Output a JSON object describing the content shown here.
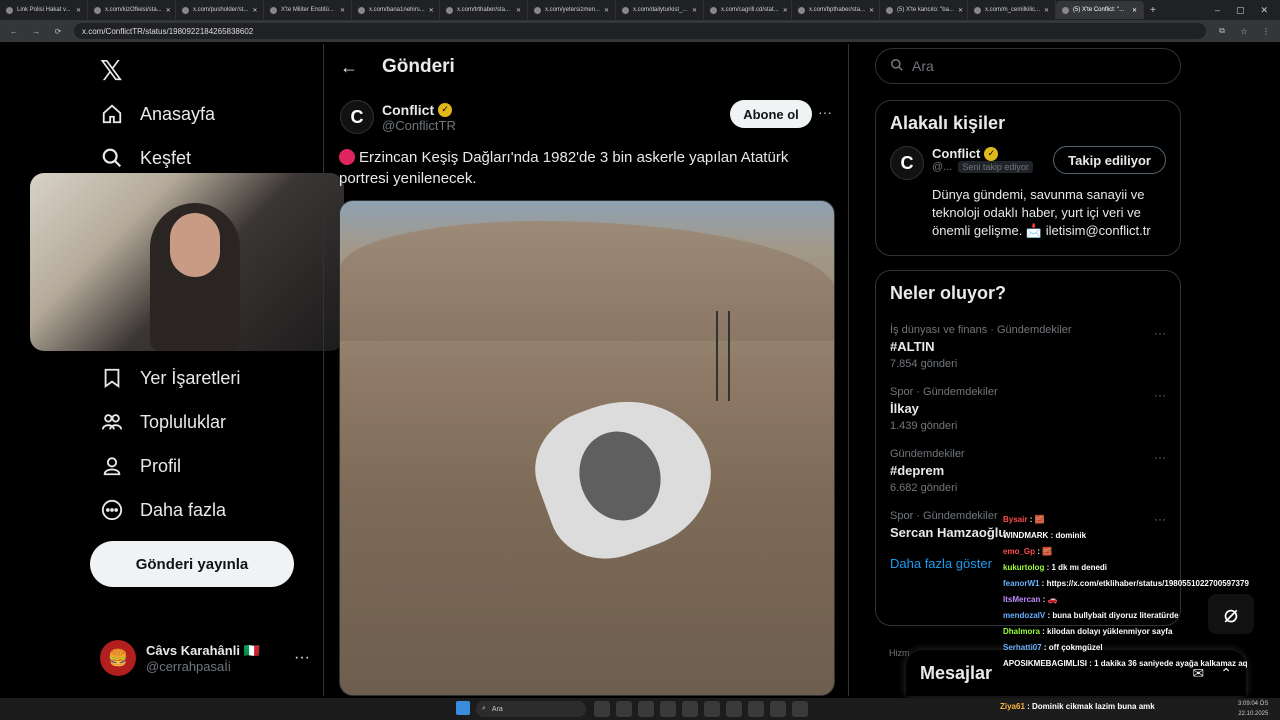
{
  "browser": {
    "tabs": [
      {
        "label": "Link Polisi Hakat v..."
      },
      {
        "label": "x.com/kizOfkesi/sta..."
      },
      {
        "label": "x.com/pusholder/st..."
      },
      {
        "label": "X'te Militer Enstitü..."
      },
      {
        "label": "x.com/bana1nehirs..."
      },
      {
        "label": "x.com/trthaber/sta..."
      },
      {
        "label": "x.com/yetersizmen..."
      },
      {
        "label": "x.com/dailyturkist_..."
      },
      {
        "label": "x.com/cagrill.cd/stat..."
      },
      {
        "label": "x.com/bpthaber/sta..."
      },
      {
        "label": "(5) X'te kancılo: \"ba..."
      },
      {
        "label": "x.com/m_cemilkilic..."
      },
      {
        "label": "(5) X'te Conflict: \"..."
      }
    ],
    "url": "x.com/ConflictTR/status/1980922184265838602"
  },
  "sidebar": {
    "items": [
      {
        "label": "Anasayfa"
      },
      {
        "label": "Keşfet"
      },
      {
        "label": "Yer İşaretleri"
      },
      {
        "label": "Topluluklar"
      },
      {
        "label": "Profil"
      },
      {
        "label": "Daha fazla"
      }
    ],
    "post_button": "Gönderi yayınla",
    "account": {
      "name": "Câvs Karahânli 🇮🇹",
      "handle": "@cerrahpasaİi"
    }
  },
  "main": {
    "title": "Gönderi",
    "post": {
      "author": "Conflict",
      "handle": "@ConflictTR",
      "subscribe_label": "Abone ol",
      "text": "Erzincan Keşiş Dağları'nda 1982'de 3 bin askerle yapılan Atatürk portresi yenilenecek."
    }
  },
  "right": {
    "search_placeholder": "Ara",
    "related": {
      "title": "Alakalı kişiler",
      "name": "Conflict",
      "handle": "@...",
      "badge": "Seni takip ediyor",
      "button": "Takip ediliyor",
      "bio": "Dünya gündemi, savunma sanayii ve teknoloji odaklı haber, yurt içi veri ve önemli gelişme. 📩 iletisim@conflict.tr"
    },
    "trends": {
      "title": "Neler oluyor?",
      "items": [
        {
          "context": "İş dünyası ve finans · Gündemdekiler",
          "name": "#ALTIN",
          "count": "7.854 gönderi"
        },
        {
          "context": "Spor · Gündemdekiler",
          "name": "İlkay",
          "count": "1.439 gönderi"
        },
        {
          "context": "Gündemdekiler",
          "name": "#deprem",
          "count": "6.682 gönderi"
        },
        {
          "context": "Spor · Gündemdekiler",
          "name": "Sercan Hamzaoğlu",
          "count": ""
        }
      ],
      "show_more": "Daha fazla göster"
    },
    "footer_hint": "Hizm..."
  },
  "messages": {
    "title": "Mesajlar"
  },
  "chat": [
    {
      "user": "Bysair",
      "color": "#ff4d4d",
      "msg": "🧱"
    },
    {
      "user": "WINDMARK",
      "color": "#ffffff",
      "msg": "dominik"
    },
    {
      "user": "emo_Gp",
      "color": "#ff4d4d",
      "msg": "🧱"
    },
    {
      "user": "kukurtolog",
      "color": "#9cff3a",
      "msg": "1 dk mı denedi"
    },
    {
      "user": "feanorW1",
      "color": "#6ab0ff",
      "msg": "https://x.com/etklihaber/status/1980551022700597379"
    },
    {
      "user": "ItsMercan",
      "color": "#c08cff",
      "msg": "🚗"
    },
    {
      "user": "mendozalV",
      "color": "#6ab0ff",
      "msg": "buna bullybait diyoruz literatürde"
    },
    {
      "user": "Dhalmora",
      "color": "#9cff3a",
      "msg": "kilodan dolayı yüklenmiyor sayfa"
    },
    {
      "user": "Serhatti07",
      "color": "#6ab0ff",
      "msg": "off çokmgüzel"
    },
    {
      "user": "APOSIKMEBAGIMLISI",
      "color": "#ffffff",
      "msg": "1 dakika 36 saniyede ayağa kalkamaz aq"
    }
  ],
  "taskbar": {
    "search": "Ara",
    "ticker_user": "Ziya61",
    "ticker_msg": "Dominik cikmak lazim buna amk",
    "time": "3:09:04 ÖS",
    "date": "22.10.2025"
  }
}
